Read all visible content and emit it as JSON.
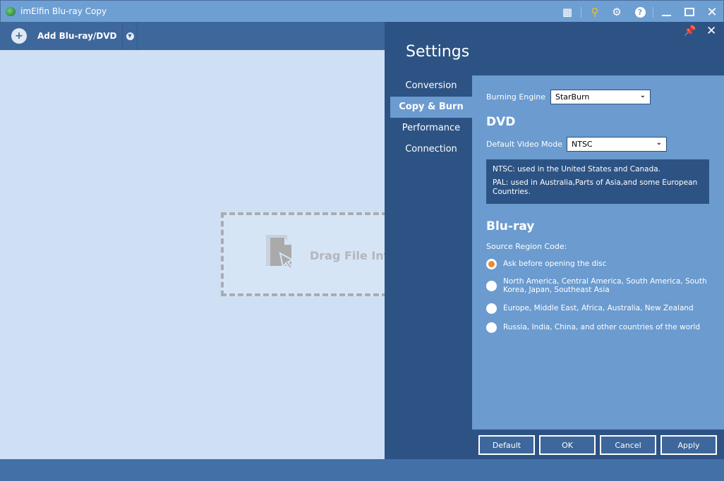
{
  "window": {
    "title": "imElfin Blu-ray Copy",
    "icons": [
      "feedback-icon",
      "key-icon",
      "gear-icon",
      "help-icon",
      "minimize-icon",
      "maximize-icon",
      "close-icon"
    ],
    "key_color": "#f0c020"
  },
  "toolbar": {
    "add_label": "Add Blu-ray/DVD"
  },
  "dropzone": {
    "text": "Drag File Into Here"
  },
  "settings": {
    "title": "Settings",
    "nav": [
      {
        "label": "Conversion"
      },
      {
        "label": "Copy & Burn",
        "active": true
      },
      {
        "label": "Performance"
      },
      {
        "label": "Connection"
      }
    ],
    "burning_engine": {
      "label": "Burning Engine",
      "value": "StarBurn"
    },
    "dvd": {
      "heading": "DVD",
      "video_mode_label": "Default Video Mode",
      "video_mode_value": "NTSC",
      "info_ntsc": "NTSC: used in the United States and Canada.",
      "info_pal": "PAL: used in Australia,Parts of Asia,and some European Countries."
    },
    "bluray": {
      "heading": "Blu-ray",
      "region_label": "Source Region Code:",
      "options": [
        {
          "label": "Ask before opening the disc",
          "selected": true
        },
        {
          "label": "North America, Central America, South America, South Korea, Japan, Southeast Asia",
          "selected": false
        },
        {
          "label": "Europe, Middle East, Africa, Australia, New Zealand",
          "selected": false
        },
        {
          "label": "Russia, India, China, and other countries of the world",
          "selected": false
        }
      ]
    },
    "buttons": {
      "default": "Default",
      "ok": "OK",
      "cancel": "Cancel",
      "apply": "Apply"
    },
    "accent": "#f08a2a"
  }
}
